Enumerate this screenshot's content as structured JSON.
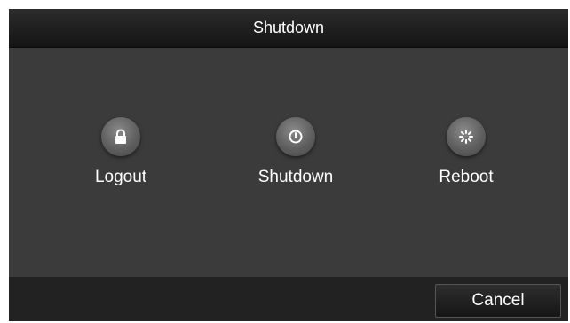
{
  "dialog": {
    "title": "Shutdown"
  },
  "options": [
    {
      "label": "Logout",
      "icon": "lock-icon"
    },
    {
      "label": "Shutdown",
      "icon": "power-icon"
    },
    {
      "label": "Reboot",
      "icon": "reboot-icon"
    }
  ],
  "footer": {
    "cancel_label": "Cancel"
  },
  "colors": {
    "titlebar": "#141414",
    "content": "#3b3b3b",
    "footer": "#222222",
    "icon_button": "#5f5f5f",
    "text": "#ffffff"
  }
}
